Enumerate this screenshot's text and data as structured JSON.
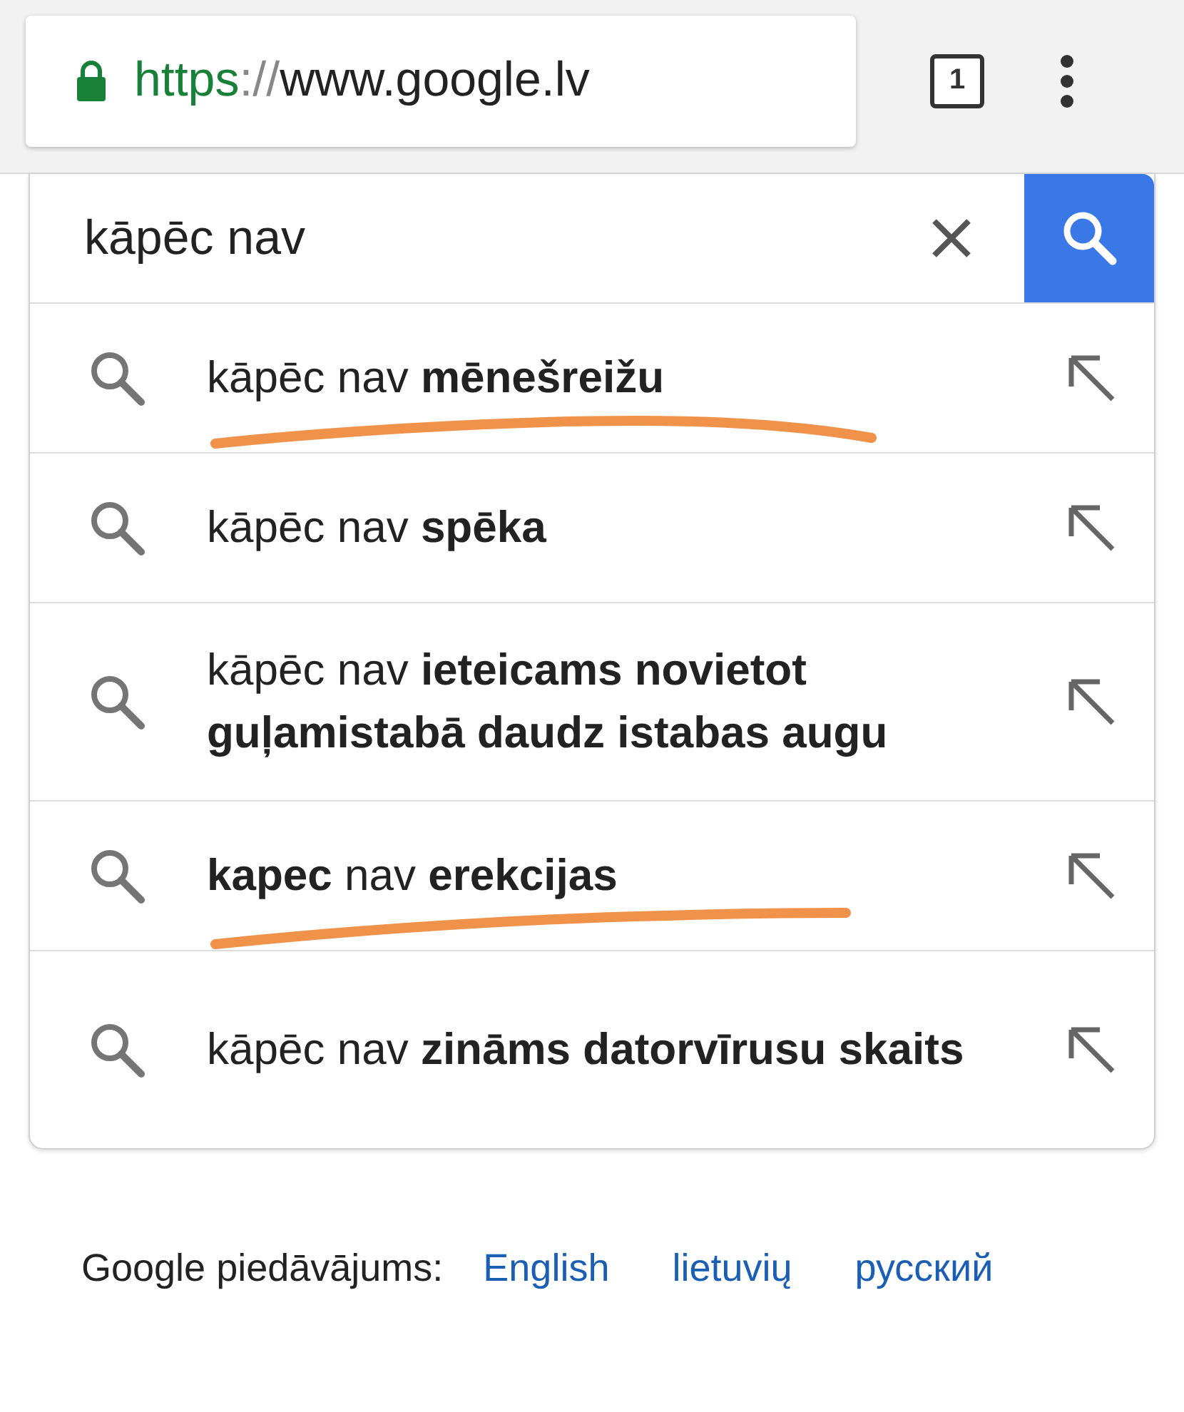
{
  "browser_bar": {
    "url": {
      "scheme": "https",
      "separator": "://",
      "host": "www.google.lv"
    },
    "secure": true,
    "tab_count": "1"
  },
  "search": {
    "value": "kāpēc nav"
  },
  "suggestions": [
    {
      "text": "kāpēc nav **mēnešreižu**",
      "underlined": true
    },
    {
      "text": "kāpēc nav **spēka**",
      "underlined": false
    },
    {
      "text": "kāpēc nav **ieteicams novietot guļamistabā daudz istabas augu**",
      "underlined": false
    },
    {
      "text": "**kapec** nav **erekcijas**",
      "underlined": true
    },
    {
      "text": "kāpēc nav **zināms datorvīrusu skaits**",
      "underlined": false
    }
  ],
  "footer": {
    "label": "Google piedāvājums:",
    "languages": [
      "English",
      "lietuvių",
      "русский"
    ]
  }
}
